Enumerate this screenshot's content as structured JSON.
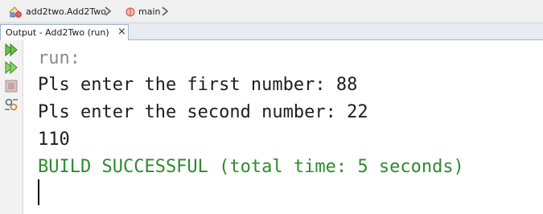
{
  "breadcrumb": {
    "class_label": "add2two.Add2Two",
    "method_label": "main"
  },
  "tab": {
    "title": "Output - Add2Two (run)",
    "close": "×"
  },
  "console": {
    "lines": [
      {
        "text": "run:",
        "color": "#8a8a8a"
      },
      {
        "text": "Pls enter the first number: 88",
        "color": "#1e1e1e"
      },
      {
        "text": "Pls enter the second number: 22",
        "color": "#1e1e1e"
      },
      {
        "text": "110",
        "color": "#1e1e1e"
      },
      {
        "text": "BUILD SUCCESSFUL (total time: 5 seconds)",
        "color": "#2e8b2e"
      }
    ]
  },
  "colors": {
    "run_arrow": "#3aa02a",
    "stop": "#c8a4a4"
  },
  "icons": [
    "class-icon",
    "chevron-right-icon",
    "method-icon",
    "rerun-icon",
    "rerun-with-options-icon",
    "stop-icon",
    "settings-icon"
  ]
}
